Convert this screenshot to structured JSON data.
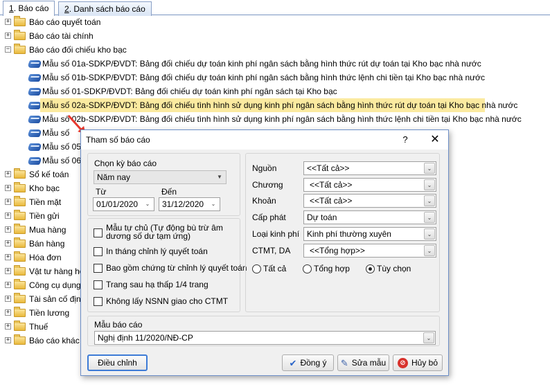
{
  "tabs": [
    {
      "num": "1",
      "label": ". Báo cáo",
      "active": true
    },
    {
      "num": "2",
      "label": ". Danh sách báo cáo",
      "active": false
    }
  ],
  "tree": [
    {
      "type": "folder",
      "label": "Báo cáo quyết toán",
      "expand": "+"
    },
    {
      "type": "folder",
      "label": "Báo cáo tài chính",
      "expand": "+"
    },
    {
      "type": "folder",
      "label": "Báo cáo đối chiếu kho bạc",
      "expand": "−"
    },
    {
      "type": "report",
      "label": "Mẫu số 01a-SDKP/ĐVDT: Bảng đối chiếu dự toán kinh phí ngân sách bằng hình thức rút dự toán tại Kho bạc nhà nước"
    },
    {
      "type": "report",
      "label": "Mẫu số 01b-SDKP/ĐVDT: Bảng đối chiếu dự toán kinh phí ngân sách bằng hình thức lệnh chi tiền tại Kho bạc nhà nước"
    },
    {
      "type": "report",
      "label": "Mẫu số 01-SDKP/ĐVDT: Bảng đối chiếu dự toán kinh phí ngân sách tại Kho bạc"
    },
    {
      "type": "report",
      "label": "Mẫu số 02a-SDKP/ĐVDT: Bảng đối chiếu tình hình sử dụng kinh phí ngân sách bằng hình thức rút dự toán tại Kho bạc nhà nước",
      "selected": true
    },
    {
      "type": "report",
      "label": "Mẫu số 02b-SDKP/ĐVDT: Bảng đối chiếu tình hình sử dụng kinh phí ngân sách bằng hình thức lệnh chi tiền tại Kho bạc nhà nước"
    },
    {
      "type": "report",
      "label": "Mẫu số"
    },
    {
      "type": "report",
      "label": "Mẫu số 05-"
    },
    {
      "type": "report",
      "label": "Mẫu số 06-"
    },
    {
      "type": "folder",
      "label": "Sổ kế toán",
      "expand": "+"
    },
    {
      "type": "folder",
      "label": "Kho bạc",
      "expand": "+"
    },
    {
      "type": "folder",
      "label": "Tiền mặt",
      "expand": "+"
    },
    {
      "type": "folder",
      "label": "Tiền gửi",
      "expand": "+"
    },
    {
      "type": "folder",
      "label": "Mua hàng",
      "expand": "+"
    },
    {
      "type": "folder",
      "label": "Bán hàng",
      "expand": "+"
    },
    {
      "type": "folder",
      "label": "Hóa đơn",
      "expand": "+"
    },
    {
      "type": "folder",
      "label": "Vật tư hàng hóa",
      "expand": "+"
    },
    {
      "type": "folder",
      "label": "Công cụ dụng c",
      "expand": "+"
    },
    {
      "type": "folder",
      "label": "Tài sản cố định",
      "expand": "+"
    },
    {
      "type": "folder",
      "label": "Tiền lương",
      "expand": "+"
    },
    {
      "type": "folder",
      "label": "Thuế",
      "expand": "+"
    },
    {
      "type": "folder",
      "label": "Báo cáo khác",
      "expand": "+"
    }
  ],
  "dialog": {
    "title": "Tham số báo cáo",
    "help": "?",
    "close": "✕",
    "period_label": "Chọn kỳ báo cáo",
    "period_value": "Năm nay",
    "from_label": "Từ",
    "from_value": "01/01/2020",
    "to_label": "Đến",
    "to_value": "31/12/2020",
    "options": [
      {
        "label": "Mẫu tự chủ (Tự động bù trừ âm dương số dư tạm ứng)",
        "checked": false
      },
      {
        "label": "In tháng chỉnh lý quyết toán",
        "checked": false
      },
      {
        "label": "Bao gồm chứng từ chỉnh lý quyết toán",
        "checked": false
      },
      {
        "label": "Trang sau hạ thấp 1/4 trang",
        "checked": false
      },
      {
        "label": "Không lấy NSNN giao cho CTMT",
        "checked": false
      }
    ],
    "filters": [
      {
        "label": "Nguồn",
        "value": "<<Tất cả>>"
      },
      {
        "label": "Chương",
        "value": "<<Tất cả>>"
      },
      {
        "label": "Khoản",
        "value": "<<Tất cả>>"
      },
      {
        "label": "Cấp phát",
        "value": "Dự toán"
      },
      {
        "label": "Loại kinh phí",
        "value": "Kinh phí thường xuyên"
      },
      {
        "label": "CTMT, DA",
        "value": "<<Tổng hợp>>"
      }
    ],
    "radios": [
      {
        "label": "Tất cả",
        "selected": false
      },
      {
        "label": "Tổng hợp",
        "selected": false
      },
      {
        "label": "Tùy chọn",
        "selected": true
      }
    ],
    "template_label": "Mẫu báo cáo",
    "template_value": "Nghị định 11/2020/NĐ-CP",
    "buttons": {
      "adjust": "Điều chỉnh",
      "ok": "Đồng ý",
      "edit_template": "Sửa mẫu",
      "cancel": "Hủy bỏ"
    }
  }
}
